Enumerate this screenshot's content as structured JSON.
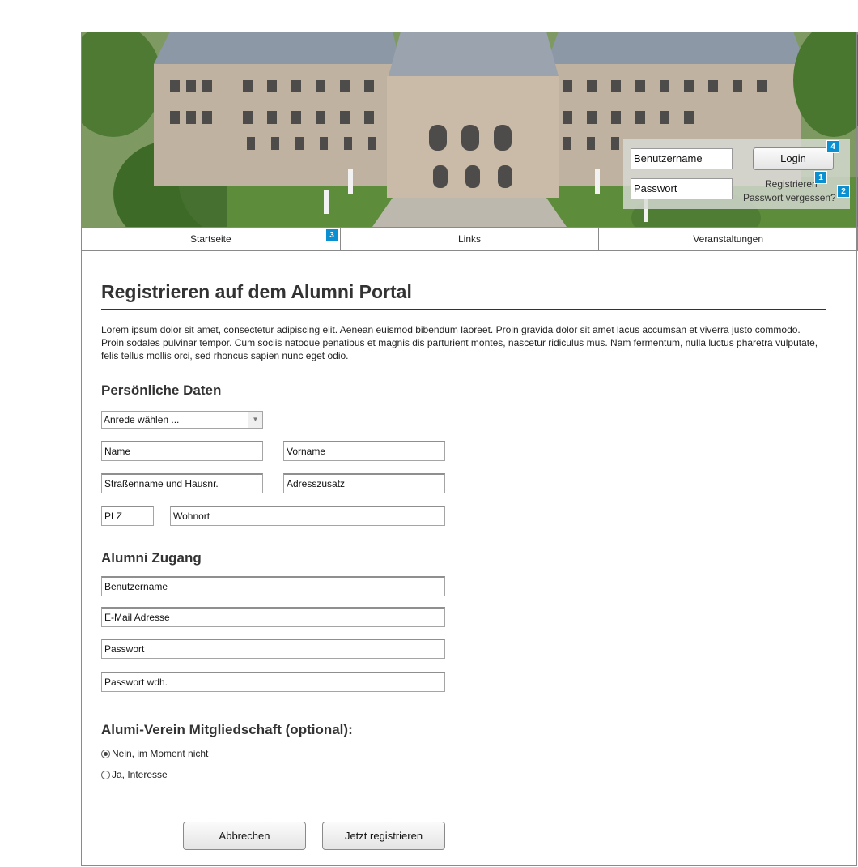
{
  "header": {
    "login": {
      "username_placeholder": "Benutzername",
      "password_placeholder": "Passwort",
      "login_label": "Login",
      "register_link": "Registrieren",
      "forgot_link": "Passwort vergessen?"
    },
    "badges": {
      "register": "1",
      "forgot": "2",
      "home": "3",
      "login": "4"
    }
  },
  "nav": {
    "items": [
      "Startseite",
      "Links",
      "Veranstaltungen"
    ]
  },
  "page": {
    "title": "Registrieren auf dem Alumni Portal",
    "intro": "Lorem ipsum dolor sit amet, consectetur adipiscing elit. Aenean euismod bibendum laoreet. Proin gravida dolor sit amet lacus accumsan et viverra justo commodo. Proin sodales pulvinar tempor. Cum sociis natoque penatibus et magnis dis parturient montes, nascetur ridiculus mus. Nam fermentum, nulla luctus pharetra vulputate, felis tellus mollis orci, sed rhoncus sapien nunc eget odio."
  },
  "personal": {
    "heading": "Persönliche Daten",
    "salutation": "Anrede wählen ...",
    "name": "Name",
    "firstname": "Vorname",
    "street": "Straßenname und Hausnr.",
    "address_extra": "Adresszusatz",
    "zip": "PLZ",
    "city": "Wohnort"
  },
  "access": {
    "heading": "Alumni Zugang",
    "username": "Benutzername",
    "email": "E-Mail Adresse",
    "password": "Passwort",
    "password_repeat": "Passwort wdh."
  },
  "membership": {
    "heading": "Alumi-Verein Mitgliedschaft (optional):",
    "options": [
      "Nein, im Moment nicht",
      "Ja, Interesse"
    ],
    "selected": 0
  },
  "actions": {
    "cancel": "Abbrechen",
    "submit": "Jetzt registrieren"
  },
  "colors": {
    "badge": "#0a8fd1",
    "border": "#8a8a8a"
  }
}
